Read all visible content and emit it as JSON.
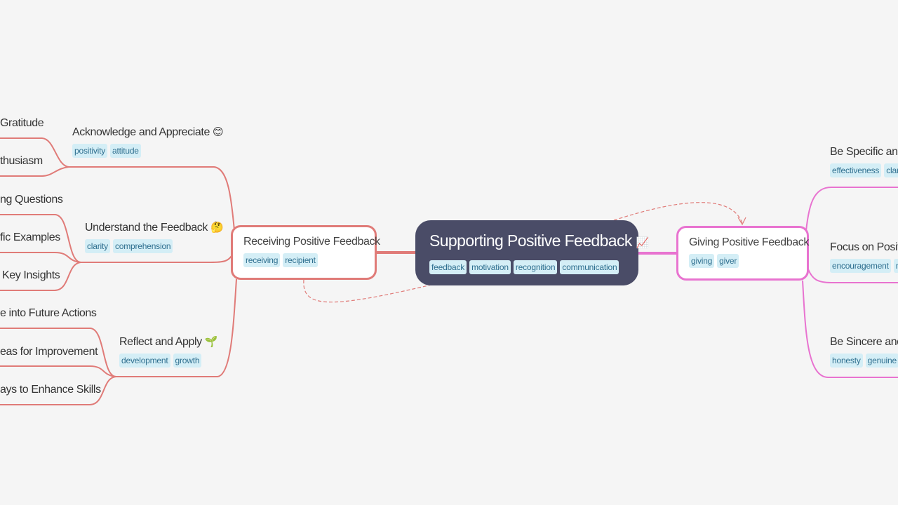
{
  "colors": {
    "background": "#f5f5f5",
    "root_fill": "#4a4c67",
    "left_branch": "#e07b78",
    "right_branch": "#e873d0",
    "tag_bg": "#d4eef6",
    "tag_text": "#2f6f8f"
  },
  "root": {
    "title": "Supporting Positive Feedback",
    "icon": "chart-increasing-icon",
    "icon_glyph": "📈",
    "tags": [
      "feedback",
      "motivation",
      "recognition",
      "communication"
    ]
  },
  "left_branch": {
    "title": "Receiving Positive Feedback",
    "tags": [
      "receiving",
      "recipient"
    ],
    "children": [
      {
        "title": "Acknowledge and Appreciate",
        "icon": "smiling-face-icon",
        "icon_glyph": "😊",
        "tags": [
          "positivity",
          "attitude"
        ],
        "leaves": [
          "Gratitude",
          "thusiasm"
        ]
      },
      {
        "title": "Understand the Feedback",
        "icon": "thinking-face-icon",
        "icon_glyph": "🤔",
        "tags": [
          "clarity",
          "comprehension"
        ],
        "leaves": [
          "ng Questions",
          "fic Examples",
          "Key Insights"
        ]
      },
      {
        "title": "Reflect and Apply",
        "icon": "seedling-icon",
        "icon_glyph": "🌱",
        "tags": [
          "development",
          "growth"
        ],
        "leaves": [
          "e into Future Actions",
          "eas for Improvement",
          "ays to Enhance Skills"
        ]
      }
    ]
  },
  "right_branch": {
    "title": "Giving Positive Feedback",
    "tags": [
      "giving",
      "giver"
    ],
    "children": [
      {
        "title": "Be Specific and T",
        "tags": [
          "effectiveness",
          "clarit"
        ]
      },
      {
        "title": "Focus on Positiv",
        "tags": [
          "encouragement",
          "m"
        ]
      },
      {
        "title": "Be Sincere and A",
        "tags": [
          "honesty",
          "genuine"
        ]
      }
    ]
  }
}
